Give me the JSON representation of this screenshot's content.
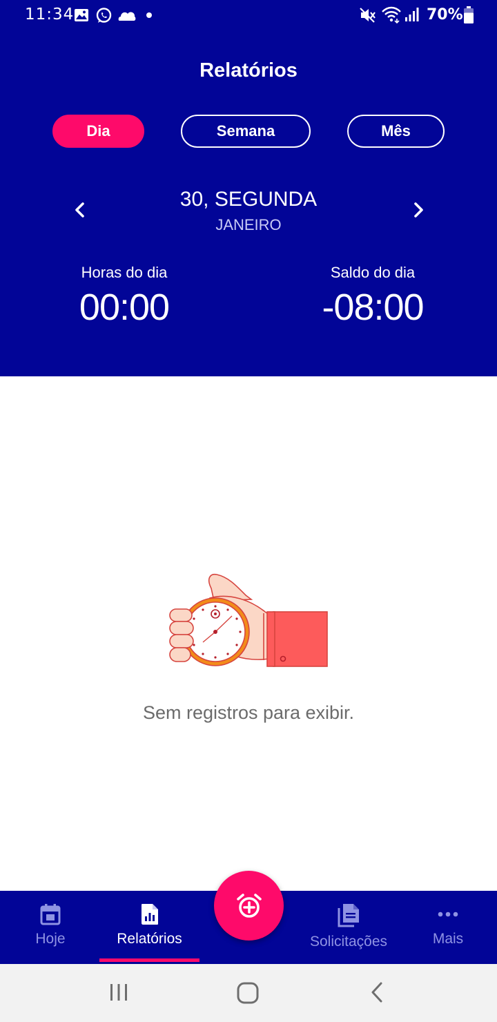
{
  "status_bar": {
    "time": "11:34",
    "battery": "70%",
    "icons": [
      "image-icon",
      "whatsapp-icon",
      "cloud-icon",
      "dot-icon",
      "mute-icon",
      "wifi-icon",
      "signal-icon",
      "battery-icon"
    ]
  },
  "header": {
    "title": "Relatórios",
    "tabs": [
      {
        "label": "Dia",
        "active": true
      },
      {
        "label": "Semana",
        "active": false
      },
      {
        "label": "Mês",
        "active": false
      }
    ],
    "date": {
      "day": "30, SEGUNDA",
      "month": "JANEIRO"
    },
    "stats": {
      "hours_label": "Horas do dia",
      "hours_value": "00:00",
      "balance_label": "Saldo do dia",
      "balance_value": "-08:00"
    }
  },
  "main": {
    "empty_message": "Sem registros para exibir."
  },
  "bottom_nav": {
    "items": [
      {
        "label": "Hoje",
        "icon": "calendar-icon",
        "active": false
      },
      {
        "label": "Relatórios",
        "icon": "report-icon",
        "active": true
      },
      {
        "label": "Solicitações",
        "icon": "documents-icon",
        "active": false
      },
      {
        "label": "Mais",
        "icon": "more-icon",
        "active": false
      }
    ],
    "fab_icon": "alarm-add-icon"
  },
  "colors": {
    "primary": "#020597",
    "accent": "#fe0a6a",
    "inactive_nav": "#8f93e3",
    "empty_text": "#6b6b6b"
  }
}
